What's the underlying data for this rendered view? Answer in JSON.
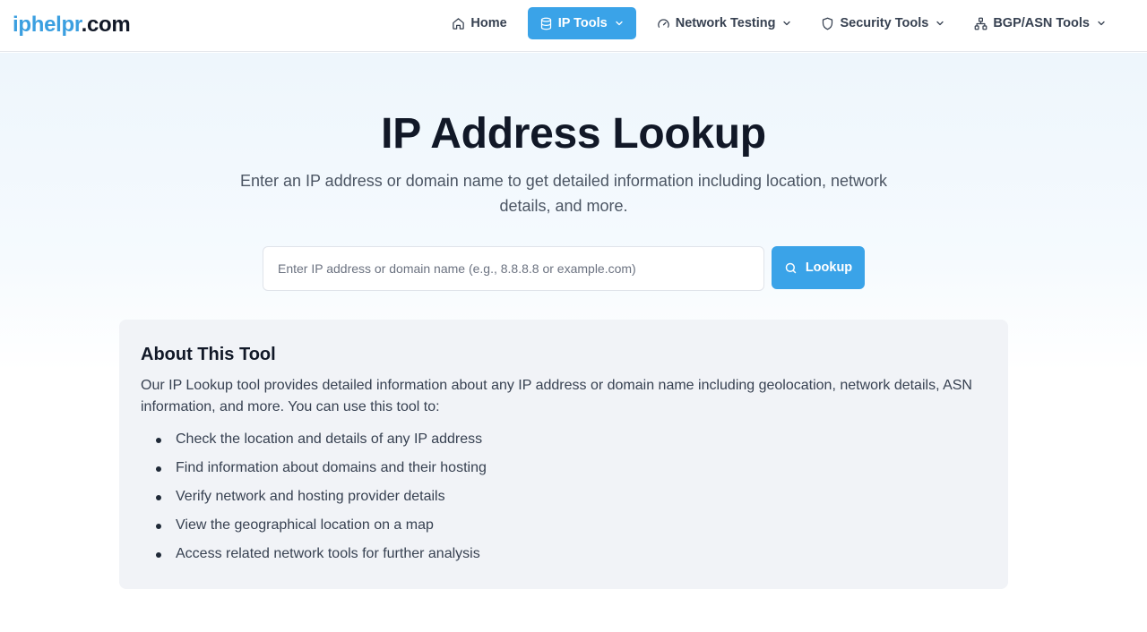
{
  "logo": {
    "brand": "iphelpr",
    "tld": ".com"
  },
  "nav": {
    "items": [
      {
        "label": "Home",
        "icon": "home-icon",
        "active": false,
        "dropdown": false
      },
      {
        "label": "IP Tools",
        "icon": "database-icon",
        "active": true,
        "dropdown": true
      },
      {
        "label": "Network Testing",
        "icon": "gauge-icon",
        "active": false,
        "dropdown": true
      },
      {
        "label": "Security Tools",
        "icon": "shield-icon",
        "active": false,
        "dropdown": true
      },
      {
        "label": "BGP/ASN Tools",
        "icon": "network-icon",
        "active": false,
        "dropdown": true
      }
    ]
  },
  "hero": {
    "title": "IP Address Lookup",
    "subtitle": "Enter an IP address or domain name to get detailed information including location, network details, and more."
  },
  "search": {
    "value": "",
    "placeholder": "Enter IP address or domain name (e.g., 8.8.8.8 or example.com)",
    "button_label": "Lookup",
    "button_icon": "search-icon"
  },
  "about": {
    "heading": "About This Tool",
    "body": "Our IP Lookup tool provides detailed information about any IP address or domain name including geolocation, network details, ASN information, and more. You can use this tool to:",
    "items": [
      "Check the location and details of any IP address",
      "Find information about domains and their hosting",
      "Verify network and hosting provider details",
      "View the geographical location on a map",
      "Access related network tools for further analysis"
    ]
  },
  "colors": {
    "accent": "#3aa3e8",
    "brand": "#3b9fe0",
    "text": "#111827",
    "panel": "#f1f3f7"
  }
}
